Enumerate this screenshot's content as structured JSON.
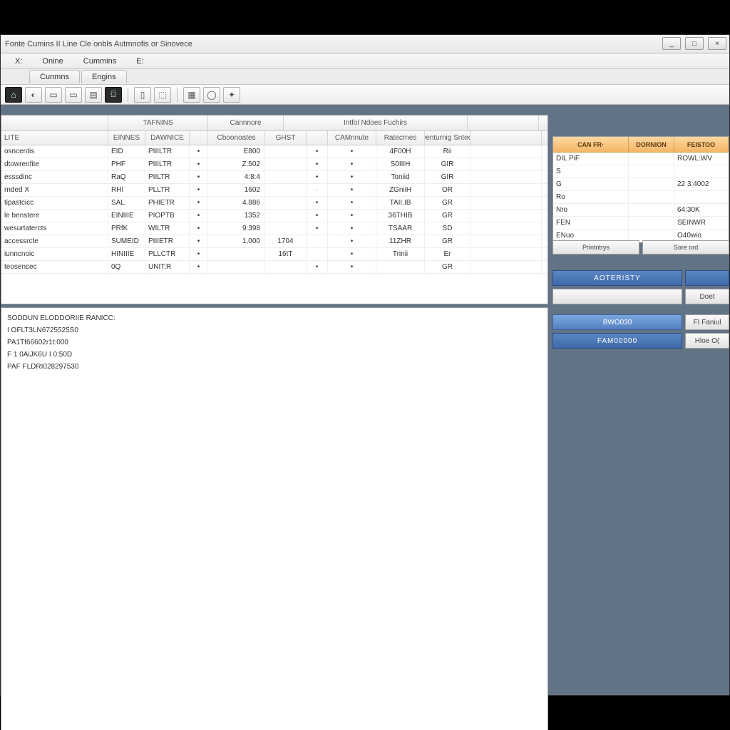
{
  "window": {
    "title": "Fonte Cumins II Line Cle onbls Autmnofis or Sinovece",
    "min_icon": "_",
    "max_icon": "□",
    "close_icon": "×"
  },
  "menubar": {
    "items": [
      "X:",
      "Onine",
      "Cummins",
      "E:"
    ]
  },
  "subtabs": {
    "items": [
      "Cunmns",
      "Engins"
    ]
  },
  "toolbar_icons": [
    "⌂",
    "◐",
    "▭",
    "▭",
    "▤",
    "⌼",
    "▯",
    "⬚",
    "▦",
    "◯",
    "✦"
  ],
  "table": {
    "super_headers": {
      "c0": "",
      "grp1": "TAFNINS",
      "grp2": "Cannnore",
      "grp3": "Intfol Ndoes Fuchirs"
    },
    "headers": {
      "c0": "LITE",
      "c1": "EINNES",
      "c2": "DAWNICE",
      "c3": "",
      "c4": "Cboonoates",
      "c5": "GHST",
      "c6": "",
      "c7": "CAMnnute",
      "c8": "Ratecrnes",
      "c9": "Denturnig Sntecr",
      "cr": ""
    },
    "rows": [
      {
        "c0": "osncentis",
        "c1": "EID",
        "c2": "PIIILTR",
        "c3": "•",
        "c4": "E800",
        "c5": "",
        "c6": "•",
        "c7": "•",
        "c8": "4F00H",
        "c9": "Rii",
        "cr": ""
      },
      {
        "c0": "dtowrenfite",
        "c1": "PHF",
        "c2": "PIIILTR",
        "c3": "•",
        "c4": "Z:502",
        "c5": "",
        "c6": "•",
        "c7": "•",
        "c8": "S0IIIH",
        "c9": "GIR",
        "cr": ""
      },
      {
        "c0": "esssdinc",
        "c1": "RaQ",
        "c2": "PIILTR",
        "c3": "•",
        "c4": "4:8:4",
        "c5": "",
        "c6": "•",
        "c7": "•",
        "c8": "Toniid",
        "c9": "GIR",
        "cr": ""
      },
      {
        "c0": "rnded X",
        "c1": "RHI",
        "c2": "PLLTR",
        "c3": "•",
        "c4": "1602",
        "c5": "",
        "c6": "·",
        "c7": "•",
        "c8": "ZGniiH",
        "c9": "OR",
        "cr": ""
      },
      {
        "c0": "tipastcicc",
        "c1": "SAL",
        "c2": "PHIETR",
        "c3": "•",
        "c4": "4.886",
        "c5": "",
        "c6": "•",
        "c7": "•",
        "c8": "TAII.IB",
        "c9": "GR",
        "cr": ""
      },
      {
        "c0": "le benstere",
        "c1": "EINIIIE",
        "c2": "PIOPTB",
        "c3": "•",
        "c4": "1352",
        "c5": "",
        "c6": "•",
        "c7": "•",
        "c8": "36THIB",
        "c9": "GR",
        "cr": ""
      },
      {
        "c0": "wesurtatercts",
        "c1": "PRfK",
        "c2": "WILTR",
        "c3": "•",
        "c4": "9:398",
        "c5": "",
        "c6": "•",
        "c7": "•",
        "c8": "TSAAR",
        "c9": "SD",
        "cr": ""
      },
      {
        "c0": "accessrcte",
        "c1": "SUMEID",
        "c2": "PIIIETR",
        "c3": "•",
        "c4": "1,000",
        "c5": "1704",
        "c6": "",
        "c7": "•",
        "c8": "11ZHR",
        "c9": "GR",
        "cr": ""
      },
      {
        "c0": "iunncnoic",
        "c1": "HINIIIE",
        "c2": "PLLCTR",
        "c3": "•",
        "c4": "",
        "c5": "16tT",
        "c6": "",
        "c7": "•",
        "c8": "Trinii",
        "c9": "Er",
        "cr": ""
      },
      {
        "c0": "teosencec",
        "c1": "0Q",
        "c2": "UNIT:R",
        "c3": "•",
        "c4": "",
        "c5": "",
        "c6": "•",
        "c7": "•",
        "c8": "",
        "c9": "GR",
        "cr": ""
      }
    ]
  },
  "textblock": {
    "line0": "SODDUN ELODDORIIE RANICC:",
    "line1": "I OFLT3LN6725525S0",
    "line2": "PA1Tf66602r1t:000",
    "line3": "F 1 0AiJK6U I 0:50D",
    "line4": "PAF FLDRI028297530"
  },
  "sidegrid": {
    "headers": {
      "h0": "CAN FR·",
      "h1": "DORNION",
      "h2": "FEISTOO"
    },
    "rows": [
      {
        "c0": "DIL PiF",
        "c1": "",
        "c2": "ROWL:WV"
      },
      {
        "c0": "S",
        "c1": "",
        "c2": ""
      },
      {
        "c0": "G",
        "c1": "",
        "c2": "22 3:4002"
      },
      {
        "c0": "Ro",
        "c1": "",
        "c2": ""
      },
      {
        "c0": "Nro",
        "c1": "",
        "c2": "64:30K"
      },
      {
        "c0": "FEN",
        "c1": "",
        "c2": "SEINWR"
      },
      {
        "c0": "ENuo",
        "c1": "",
        "c2": "O40wio"
      }
    ]
  },
  "sidebuttons": {
    "b0": "Printntrys",
    "b1": "Sore ord"
  },
  "actions": {
    "row1a": "AOTERISTY",
    "row1b": "",
    "row2a": "",
    "row2b": "Doet",
    "row3a": "BWO030",
    "row3b": "FI Faniul",
    "row4a": "FAM00000",
    "row4b": "Hloe O("
  }
}
